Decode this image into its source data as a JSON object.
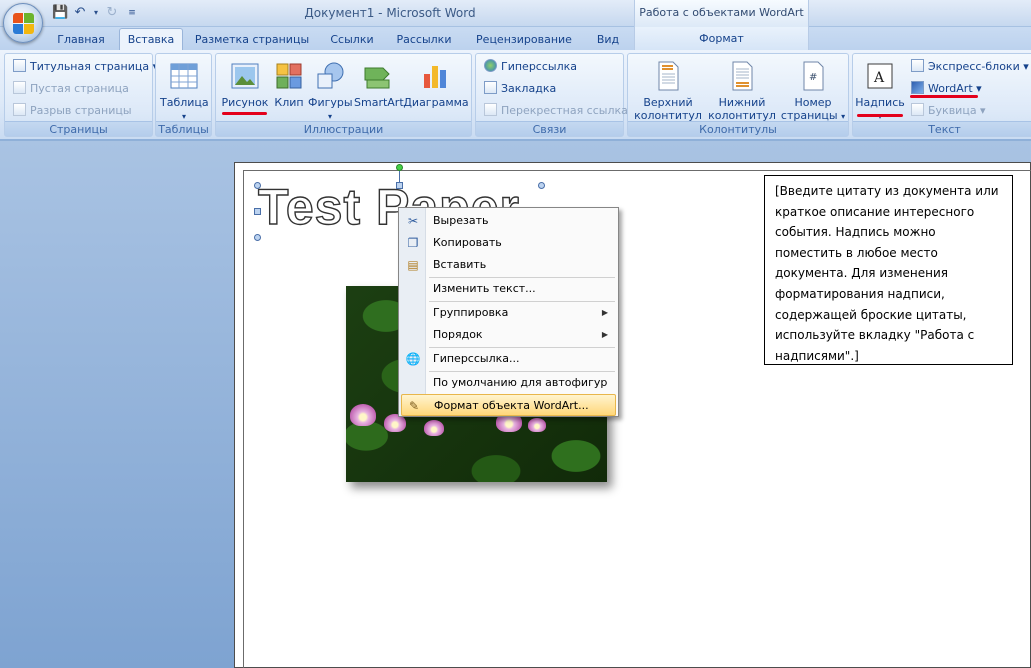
{
  "window": {
    "title": "Документ1 - Microsoft Word",
    "context_title": "Работа с объектами WordArt"
  },
  "tabs": [
    "Главная",
    "Вставка",
    "Разметка страницы",
    "Ссылки",
    "Рассылки",
    "Рецензирование",
    "Вид",
    "Формат"
  ],
  "active_tab": "Вставка",
  "ribbon": {
    "pages": {
      "label": "Страницы",
      "items": [
        "Титульная страница",
        "Пустая страница",
        "Разрыв страницы"
      ]
    },
    "tables": {
      "label": "Таблицы",
      "table_button": "Таблица"
    },
    "illustrations": {
      "label": "Иллюстрации",
      "buttons": [
        "Рисунок",
        "Клип",
        "Фигуры",
        "SmartArt",
        "Диаграмма"
      ]
    },
    "links": {
      "label": "Связи",
      "items": [
        "Гиперссылка",
        "Закладка",
        "Перекрестная ссылка"
      ]
    },
    "header_footer": {
      "label": "Колонтитулы",
      "buttons": [
        {
          "line1": "Верхний",
          "line2": "колонтитул"
        },
        {
          "line1": "Нижний",
          "line2": "колонтитул"
        },
        {
          "line1": "Номер",
          "line2": "страницы"
        }
      ]
    },
    "text": {
      "label": "Текст",
      "textbox_button": "Надпись",
      "items": [
        "Экспресс-блоки",
        "WordArt",
        "Буквица"
      ]
    }
  },
  "document": {
    "wordart_text": "Test Paper",
    "textbox_text": "[Введите цитату из документа или краткое описание интересного события. Надпись можно поместить в любое место документа. Для изменения форматирования надписи, содержащей броские цитаты, используйте вкладку \"Работа с надписями\".]"
  },
  "context_menu": {
    "items": [
      {
        "label": "Вырезать",
        "icon": "scissors-icon"
      },
      {
        "label": "Копировать",
        "icon": "copy-icon"
      },
      {
        "label": "Вставить",
        "icon": "paste-icon"
      },
      {
        "label": "Изменить текст...",
        "icon": ""
      },
      {
        "label": "Группировка",
        "icon": "",
        "submenu": true
      },
      {
        "label": "Порядок",
        "icon": "",
        "submenu": true
      },
      {
        "label": "Гиперссылка...",
        "icon": "hyperlink-icon"
      },
      {
        "label": "По умолчанию для автофигур",
        "icon": ""
      },
      {
        "label": "Формат объекта WordArt...",
        "icon": "format-wordart-icon",
        "highlighted": true
      }
    ]
  },
  "colors": {
    "highlight": "#ffd77a",
    "annotation_red": "#e3001b",
    "ribbon_text": "#15428b"
  }
}
